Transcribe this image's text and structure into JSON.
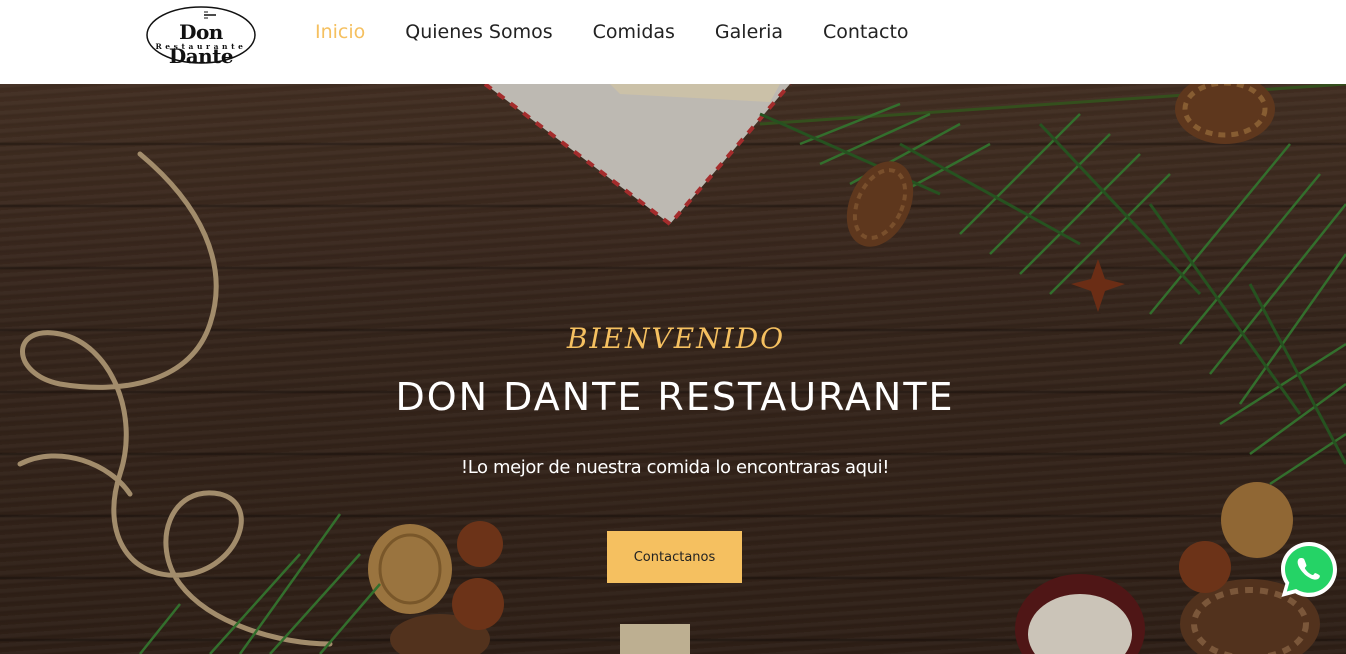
{
  "header": {
    "logo": {
      "title": "Don Dante",
      "subtitle": "Restaurante"
    },
    "nav": [
      {
        "label": "Inicio",
        "active": true
      },
      {
        "label": "Quienes Somos",
        "active": false
      },
      {
        "label": "Comidas",
        "active": false
      },
      {
        "label": "Galeria",
        "active": false
      },
      {
        "label": "Contacto",
        "active": false
      }
    ]
  },
  "hero": {
    "welcome": "BIENVENIDO",
    "title": "DON DANTE RESTAURANTE",
    "subtitle": "!Lo mejor de nuestra comida lo encontraras aqui!",
    "cta_label": "Contactanos"
  },
  "floating": {
    "whatsapp_icon": "whatsapp-icon"
  },
  "colors": {
    "accent": "#f5c060",
    "nav_text": "#222222",
    "hero_text": "#ffffff",
    "whatsapp_green": "#25d366"
  }
}
